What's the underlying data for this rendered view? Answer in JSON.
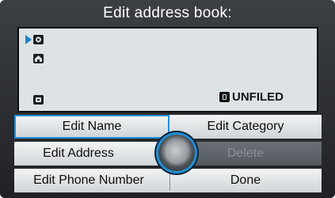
{
  "title": "Edit address book:",
  "entry": {
    "category_label": "UNFILED",
    "icons": [
      "person-icon",
      "home-icon",
      "phone-icon",
      "category-icon"
    ]
  },
  "menu": {
    "edit_name": "Edit Name",
    "edit_category": "Edit Category",
    "edit_address": "Edit Address",
    "delete": "Delete",
    "edit_phone_number": "Edit Phone Number",
    "done": "Done"
  },
  "colors": {
    "accent": "#1e90d6",
    "background": "#2b2e32",
    "panel": "#dde2e4"
  }
}
